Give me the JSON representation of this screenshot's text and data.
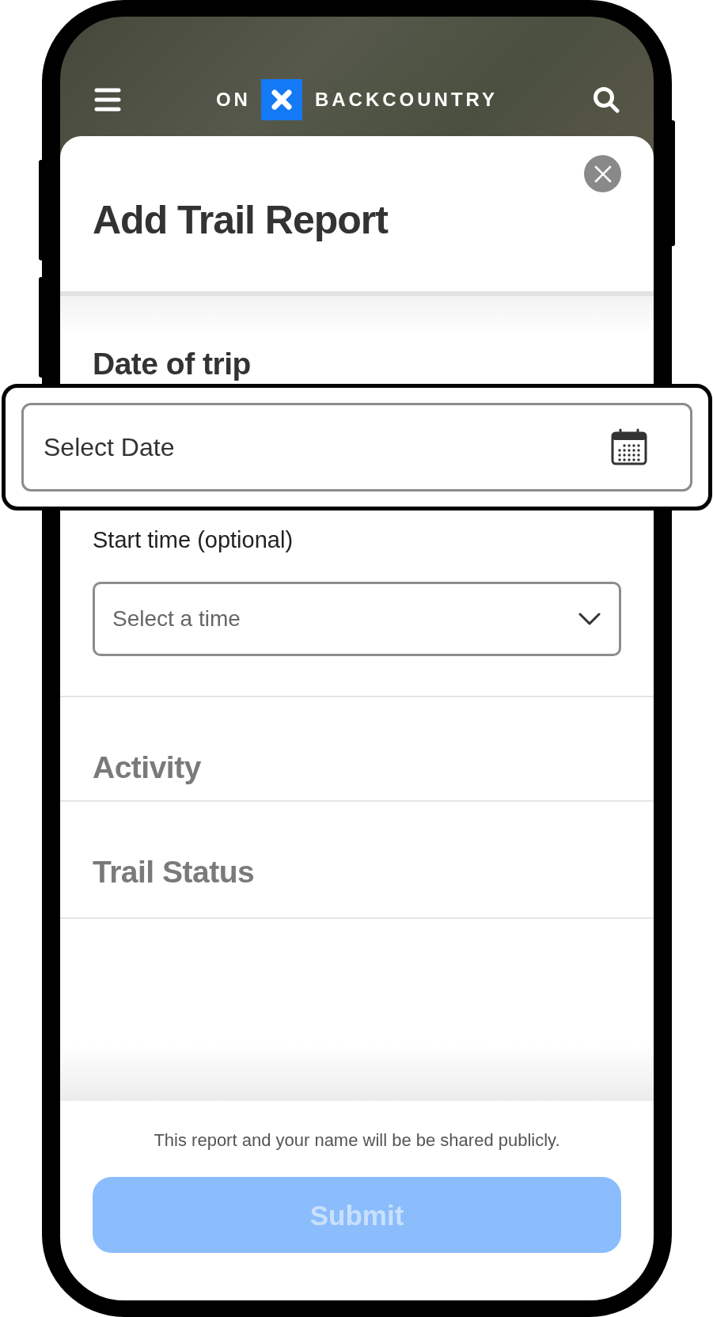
{
  "header": {
    "logo": {
      "left": "ON",
      "right": "BACKCOUNTRY"
    }
  },
  "modal": {
    "title": "Add Trail Report"
  },
  "date_section": {
    "heading": "Date of trip",
    "date_field": {
      "placeholder": "Select Date",
      "highlighted": true
    },
    "time_label": "Start time (optional)",
    "time_select": {
      "placeholder": "Select a time"
    }
  },
  "sections": [
    {
      "heading": "Activity",
      "disabled": true
    },
    {
      "heading": "Trail Status",
      "disabled": true
    }
  ],
  "footer": {
    "notice": "This report and your name will be be shared publicly.",
    "submit_button": {
      "label": "Submit",
      "disabled": true
    }
  }
}
